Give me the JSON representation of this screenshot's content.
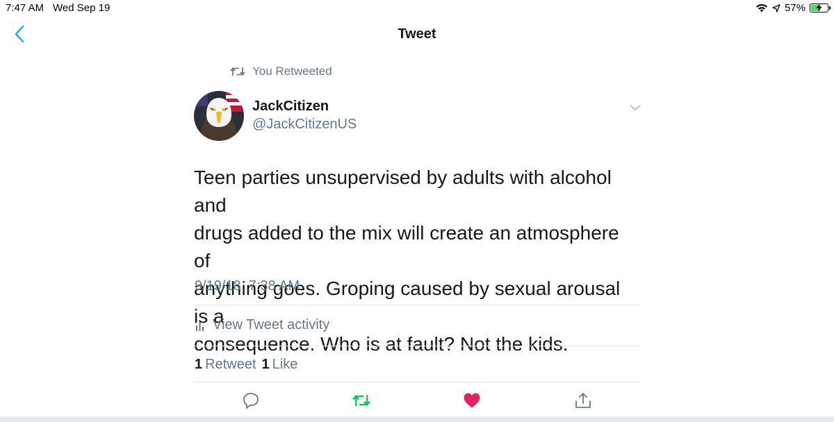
{
  "status_bar": {
    "time": "7:47 AM",
    "date": "Wed Sep 19",
    "battery": "57%",
    "battery_level": 0.57,
    "icons": [
      "wifi-icon",
      "location-arrow-icon",
      "battery-charging-icon"
    ]
  },
  "nav": {
    "title": "Tweet",
    "back_icon": "chevron-left-icon"
  },
  "retweet_context": {
    "label": "You Retweeted",
    "icon": "retweet-icon"
  },
  "author": {
    "name": "JackCitizen",
    "handle": "@JackCitizenUS",
    "avatar": "eagle-avatar"
  },
  "tweet": {
    "text": "Teen parties unsupervised by adults with alcohol and\ndrugs added to the mix will create an atmosphere of\nanything goes.  Groping caused by sexual arousal is a\nconsequence.  Who is at fault?  Not the kids.",
    "timestamp": "9/19/18, 7:38 AM"
  },
  "activity": {
    "label": "View Tweet activity",
    "icon": "bar-chart-icon"
  },
  "stats": {
    "retweet_count": "1",
    "retweet_label": "Retweet",
    "like_count": "1",
    "like_label": "Like"
  },
  "actions": [
    {
      "name": "reply",
      "icon": "reply-bubble-icon"
    },
    {
      "name": "retweet",
      "icon": "retweet-icon",
      "active": true
    },
    {
      "name": "like",
      "icon": "heart-icon",
      "active": true
    },
    {
      "name": "share",
      "icon": "share-icon"
    }
  ],
  "colors": {
    "twitter_blue": "#1da1f2",
    "retweet_green": "#17bf63",
    "like_red": "#e0245e",
    "secondary_text": "#657786",
    "divider": "#e1e8ed",
    "battery_green": "#4cd964"
  }
}
